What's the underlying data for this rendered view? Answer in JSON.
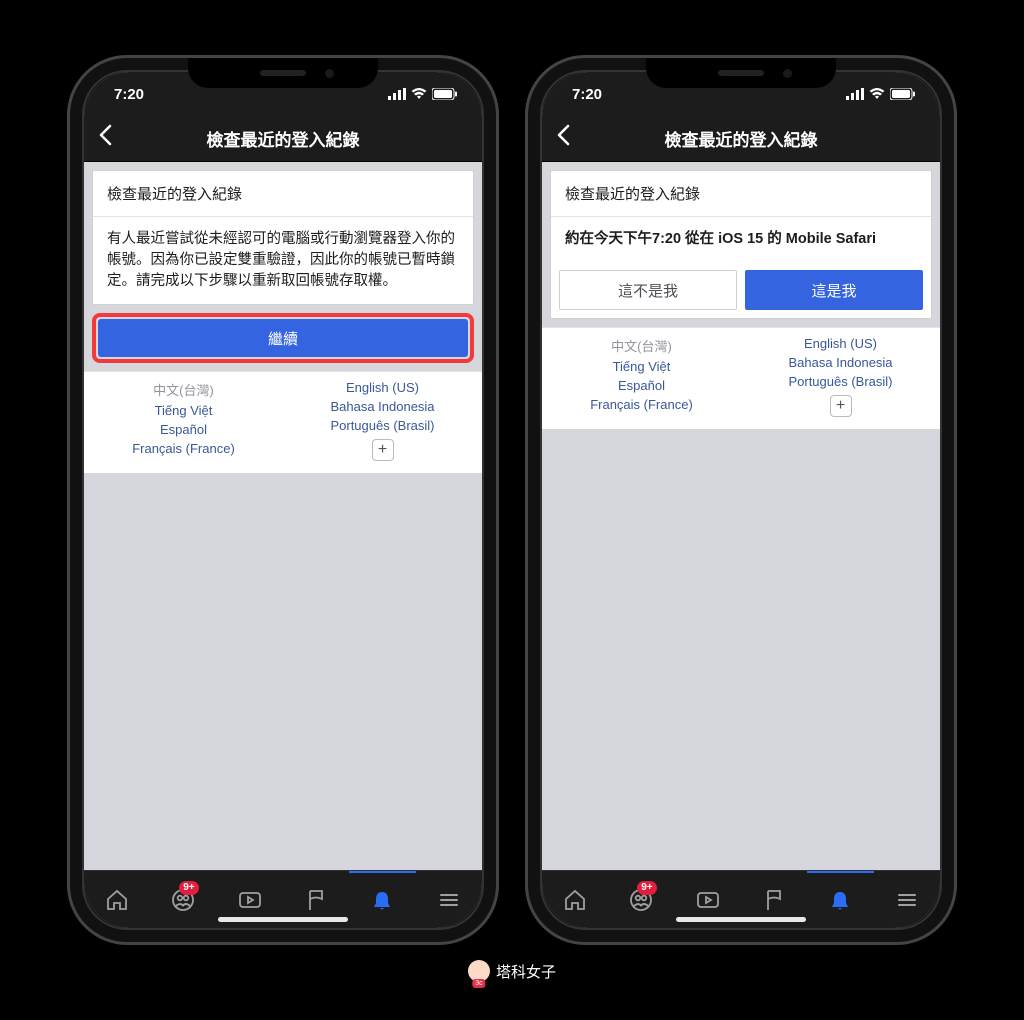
{
  "status": {
    "time": "7:20"
  },
  "nav": {
    "title": "檢查最近的登入紀錄"
  },
  "left": {
    "card_title": "檢查最近的登入紀錄",
    "body": "有人最近嘗試從未經認可的電腦或行動瀏覽器登入你的帳號。因為你已設定雙重驗證，因此你的帳號已暫時鎖定。請完成以下步驟以重新取回帳號存取權。",
    "continue": "繼續"
  },
  "right": {
    "card_title": "檢查最近的登入紀錄",
    "body": "約在今天下午7:20 從在 iOS 15 的 Mobile Safari",
    "not_me": "這不是我",
    "is_me": "這是我"
  },
  "langs": {
    "left": [
      "中文(台灣)",
      "Tiếng Việt",
      "Español",
      "Français (France)"
    ],
    "right": [
      "English (US)",
      "Bahasa Indonesia",
      "Português (Brasil)"
    ]
  },
  "tabs": {
    "badge": "9+"
  },
  "watermark": "塔科女子"
}
